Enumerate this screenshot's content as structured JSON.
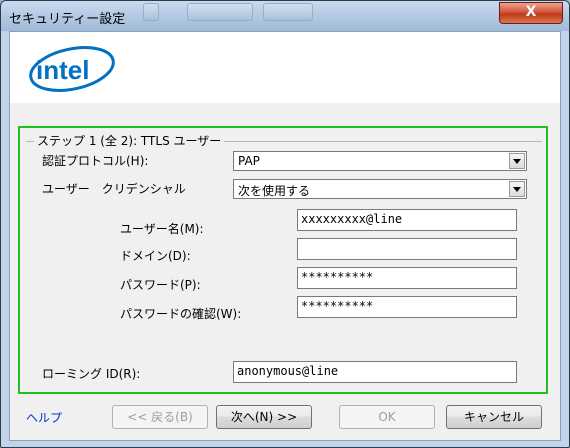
{
  "window": {
    "title": "セキュリティー設定",
    "close_glyph": "X"
  },
  "section": {
    "legend": "ステップ 1 (全 2): TTLS ユーザー"
  },
  "form": {
    "auth_protocol_label": "認証プロトコル(H):",
    "auth_protocol_value": "PAP",
    "credentials_label": "ユーザー　クリデンシャル",
    "credentials_value": "次を使用する",
    "username_label": "ユーザー名(M):",
    "username_value": "xxxxxxxxx@line",
    "domain_label": "ドメイン(D):",
    "domain_value": "",
    "password_label": "パスワード(P):",
    "password_value": "**********",
    "confirm_label": "パスワードの確認(W):",
    "confirm_value": "**********",
    "roaming_label": "ローミング ID(R):",
    "roaming_value": "anonymous@line"
  },
  "footer": {
    "help": "ヘルプ",
    "back": "<< 戻る(B)",
    "next": "次へ(N) >>",
    "ok": "OK",
    "cancel": "キャンセル"
  },
  "logo_text": "intel"
}
